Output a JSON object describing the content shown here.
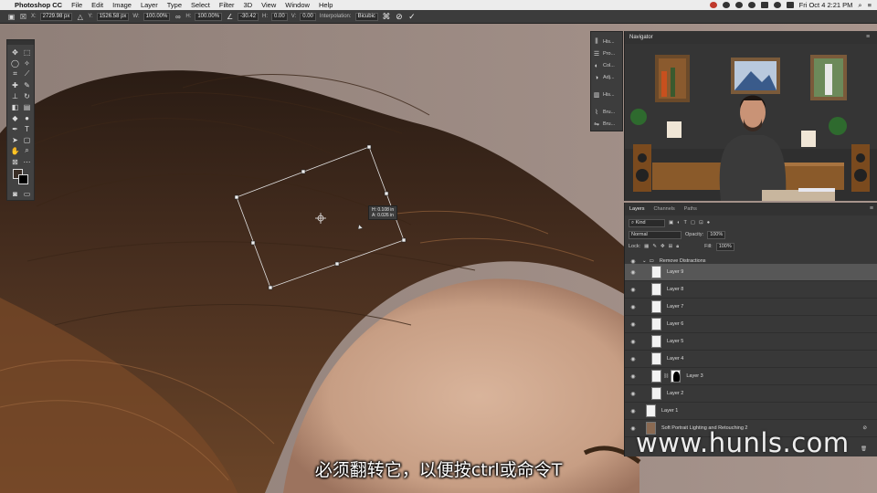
{
  "menubar": {
    "app_name": "Photoshop CC",
    "items": [
      "File",
      "Edit",
      "Image",
      "Layer",
      "Type",
      "Select",
      "Filter",
      "3D",
      "View",
      "Window",
      "Help"
    ],
    "clock": "Fri Oct 4  2:21 PM"
  },
  "options_bar": {
    "x_label": "X:",
    "x_value": "2729.98 px",
    "y_label": "Y:",
    "y_value": "1526.58 px",
    "w_label": "W:",
    "w_value": "100.00%",
    "h_label": "H:",
    "h_value": "100.00%",
    "angle_value": "-30.42",
    "hskew_label": "H:",
    "hskew_value": "0.00",
    "vskew_label": "V:",
    "vskew_value": "0.00",
    "interpolation_label": "Interpolation:",
    "interpolation_value": "Bicubic"
  },
  "transform_readout": {
    "line1": "H: 0.108 in",
    "line2": "A: 0.026 in"
  },
  "collapsed_panel": {
    "items": [
      "His...",
      "Pro...",
      "Col...",
      "Adj...",
      "His...",
      "Bru...",
      "Bru..."
    ]
  },
  "navigator": {
    "title": "Navigator"
  },
  "layers_panel": {
    "tabs": [
      "Layers",
      "Channels",
      "Paths"
    ],
    "filter_kind": "Kind",
    "blend_mode": "Normal",
    "opacity_label": "Opacity:",
    "opacity_value": "100%",
    "lock_label": "Lock:",
    "fill_label": "Fill:",
    "fill_value": "100%",
    "group_name": "Remove Distractions",
    "layers": [
      "Layer 9",
      "Layer 8",
      "Layer 7",
      "Layer 6",
      "Layer 5",
      "Layer 4",
      "Layer 3",
      "Layer 2"
    ],
    "bottom_layer": "Layer 1",
    "background_layer": "Soft Portrait Lighting and Retouching 2"
  },
  "subtitle": "必须翻转它，以便按ctrl或命令T",
  "watermark": "www.hunls.com",
  "colors": {
    "menubar": "#ececec",
    "panel": "#383838",
    "selected_layer": "#575757",
    "foreground_swatch": "#3a2e26",
    "background_swatch": "#000000"
  }
}
